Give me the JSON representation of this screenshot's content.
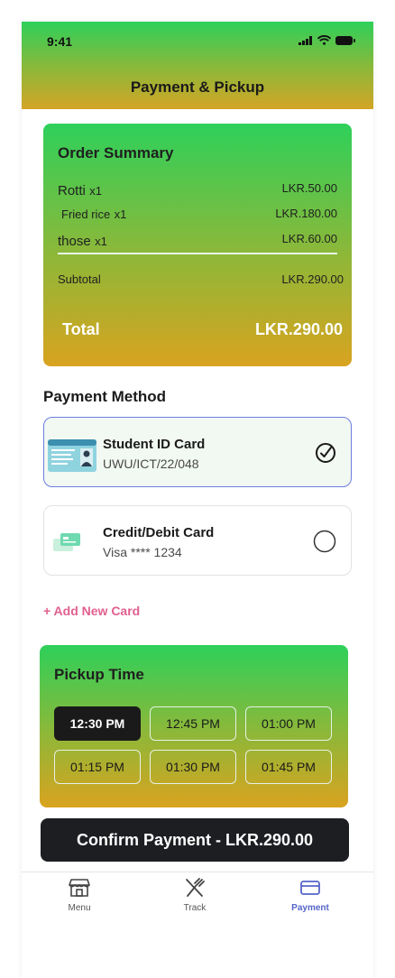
{
  "status_bar": {
    "time": "9:41"
  },
  "header": {
    "title": "Payment & Pickup"
  },
  "order_summary": {
    "title": "Order Summary",
    "items": [
      {
        "name": "Rotti",
        "qty": "x1",
        "price": "LKR.50.00"
      },
      {
        "name": "Fried rice",
        "qty": "x1",
        "price": "LKR.180.00"
      },
      {
        "name": "those",
        "qty": "x1",
        "price": "LKR.60.00"
      }
    ],
    "subtotal_label": "Subtotal",
    "subtotal_value": "LKR.290.00",
    "total_label": "Total",
    "total_value": "LKR.290.00"
  },
  "payment": {
    "section_title": "Payment Method",
    "methods": [
      {
        "title": "Student ID Card",
        "subtitle": "UWU/ICT/22/048",
        "selected": true,
        "icon": "student-id-card-icon"
      },
      {
        "title": "Credit/Debit Card",
        "subtitle": "Visa **** 1234",
        "selected": false,
        "icon": "credit-card-icon"
      }
    ],
    "add_card_label": "+ Add New Card"
  },
  "pickup": {
    "title": "Pickup Time",
    "slots": [
      "12:30 PM",
      "12:45 PM",
      "01:00 PM",
      "01:15 PM",
      "01:30 PM",
      "01:45 PM"
    ],
    "selected_slot": "12:30 PM"
  },
  "confirm_button": {
    "label": "Confirm Payment - LKR.290.00"
  },
  "tabbar": {
    "tabs": [
      {
        "label": "Menu",
        "icon": "store-icon",
        "active": false
      },
      {
        "label": "Track",
        "icon": "utensils-icon",
        "active": false
      },
      {
        "label": "Payment",
        "icon": "card-icon",
        "active": true
      }
    ]
  },
  "colors": {
    "gradient_top": "#2ed05a",
    "gradient_bottom": "#d9a31f",
    "accent_link": "#e0608f",
    "active_tab": "#5565c9",
    "confirm_bg": "#1d1e22"
  }
}
